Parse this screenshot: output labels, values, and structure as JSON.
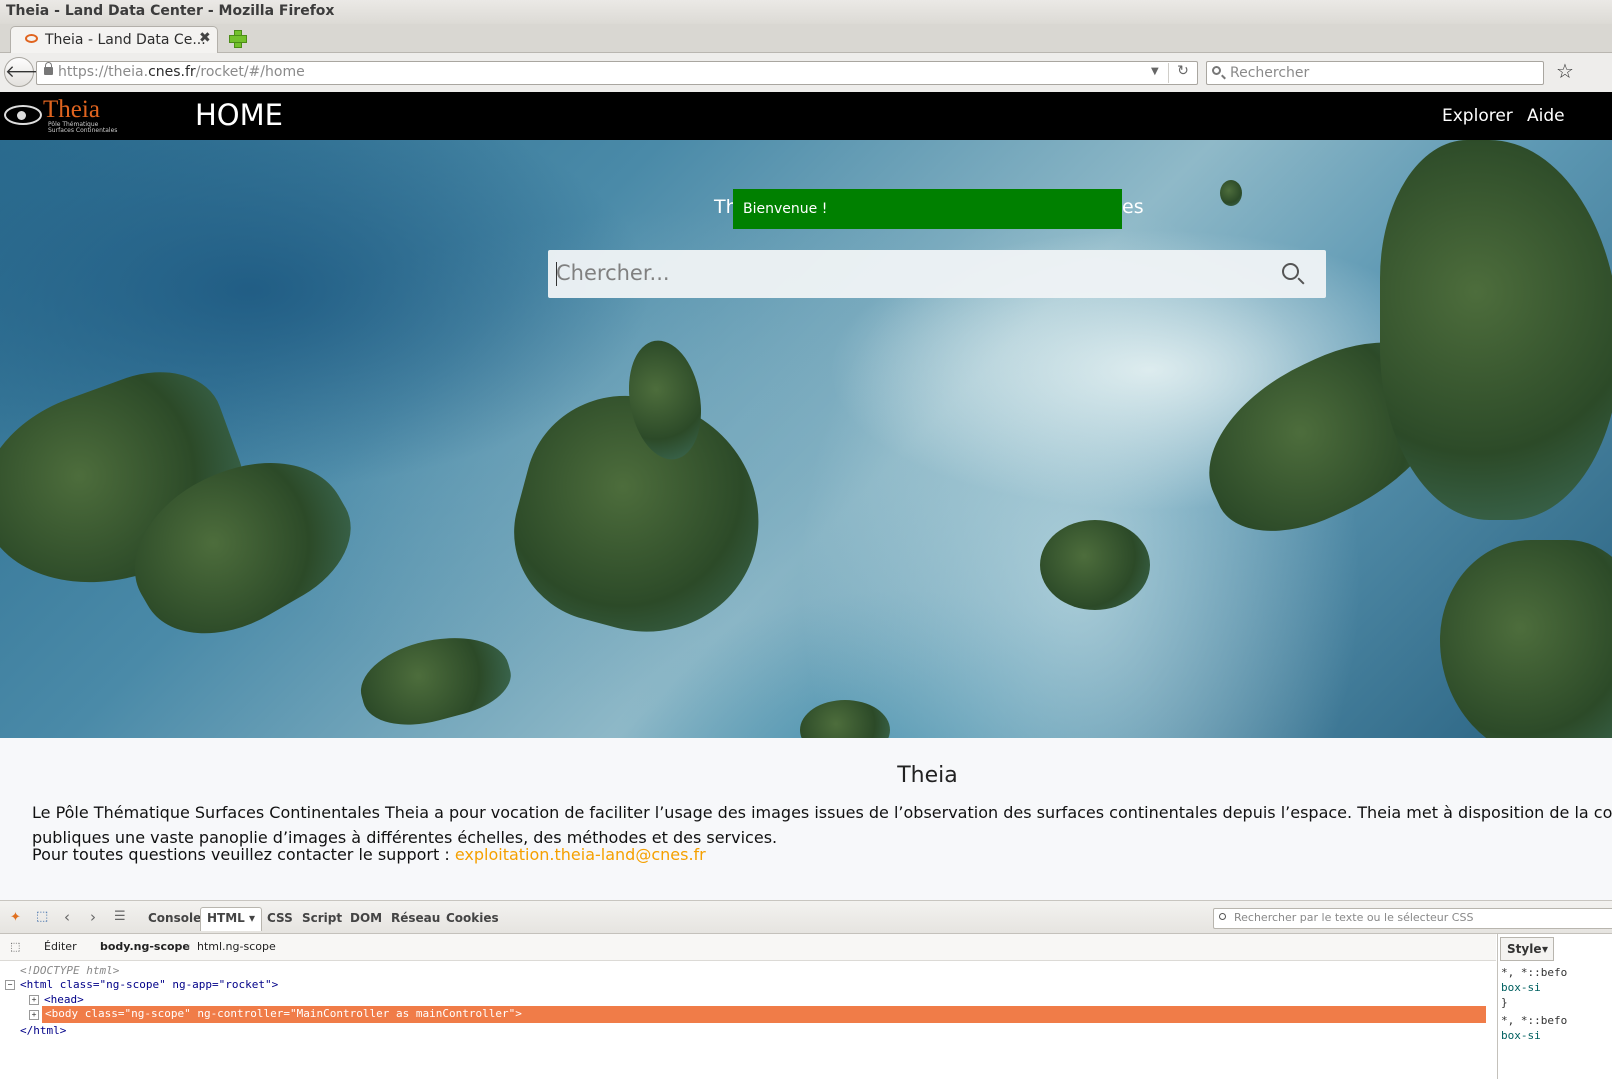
{
  "window": {
    "title": "Theia - Land Data Center - Mozilla Firefox"
  },
  "tabs": [
    {
      "label": "Theia - Land Data Ce..."
    }
  ],
  "address": {
    "url_prefix": "https://theia.",
    "url_domain": "cnes.fr",
    "url_path": "/rocket/#/home"
  },
  "search_bar": {
    "placeholder": "Rechercher"
  },
  "site": {
    "logo_name": "Theia",
    "logo_sub1": "Pôle Thématique",
    "logo_sub2": "Surfaces Continentales",
    "page_title": "HOME",
    "nav": [
      {
        "label": "Explorer"
      },
      {
        "label": "Aide"
      }
    ]
  },
  "hero": {
    "tagline_start": "Th",
    "tagline_end": "es",
    "toast": "Bienvenue !",
    "search_placeholder": "Chercher..."
  },
  "content": {
    "title": "Theia",
    "paragraph_line1": "Le Pôle Thématique Surfaces Continentales Theia a pour vocation de faciliter l’usage des images issues de l’observation des surfaces continentales depuis l’espace. Theia met à disposition de la commun",
    "paragraph_line2": "publiques une vaste panoplie d’images à différentes échelles, des méthodes et des services.",
    "support_text": "Pour toutes questions veuillez contacter le support : ",
    "support_email": "exploitation.theia-land@cnes.fr"
  },
  "devtools": {
    "tabs": [
      "Console",
      "HTML",
      "CSS",
      "Script",
      "DOM",
      "Réseau",
      "Cookies"
    ],
    "search_placeholder": "Rechercher par le texte ou le sélecteur CSS",
    "edit_label": "Éditer",
    "crumb_active": "body.ng-scope",
    "crumb_parent": "html.ng-scope",
    "tree": {
      "doctype": "<!DOCTYPE html>",
      "html_open": "<html class=\"ng-scope\" ng-app=\"rocket\">",
      "head": "<head>",
      "body": "<body class=\"ng-scope\" ng-controller=\"MainController as mainController\">",
      "html_close": "</html>"
    },
    "side_tab": "Style",
    "side_code": [
      "*, *::befo",
      "  box-si",
      "}",
      "*, *::befo",
      "  box-si"
    ]
  }
}
